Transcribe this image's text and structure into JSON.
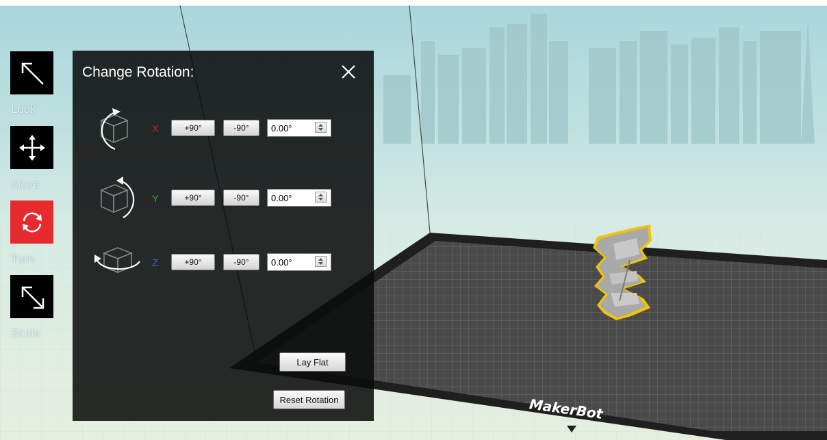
{
  "toolbar": {
    "tools": [
      {
        "label": "Look",
        "icon": "arrow-up-left-icon"
      },
      {
        "label": "Move",
        "icon": "move-arrows-icon"
      },
      {
        "label": "Turn",
        "icon": "rotate-icon",
        "active": true
      },
      {
        "label": "Scale",
        "icon": "arrow-diagonal-resize-icon"
      }
    ]
  },
  "rotation_panel": {
    "title": "Change Rotation:",
    "close_icon": "close-icon",
    "axes": [
      {
        "axis": "X",
        "color": "#c0262d",
        "plus_label": "+90°",
        "minus_label": "-90°",
        "value": "0.00°"
      },
      {
        "axis": "Y",
        "color": "#2e9e3c",
        "plus_label": "+90°",
        "minus_label": "-90°",
        "value": "0.00°"
      },
      {
        "axis": "Z",
        "color": "#3a62d8",
        "plus_label": "+90°",
        "minus_label": "-90°",
        "value": "0.00°"
      }
    ],
    "lay_flat_label": "Lay Flat",
    "reset_rotation_label": "Reset Rotation"
  },
  "scene": {
    "build_plate_logo": "MakerBot",
    "model_outline_color": "#f2c500",
    "active_tool_color": "#e62b2e"
  }
}
